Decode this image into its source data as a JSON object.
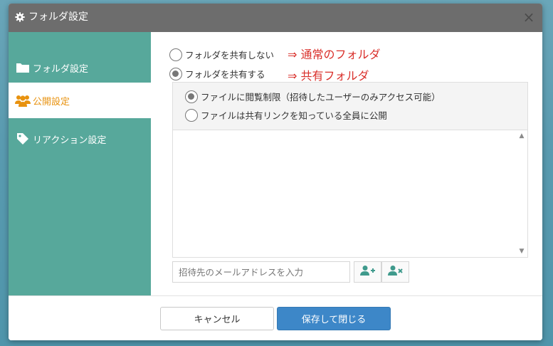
{
  "dialog": {
    "title": "フォルダ設定",
    "close_label": "×"
  },
  "sidebar": {
    "items": [
      {
        "label": "フォルダ設定",
        "icon": "folder-icon",
        "active": false
      },
      {
        "label": "公開設定",
        "icon": "users-icon",
        "active": true
      },
      {
        "label": "リアクション設定",
        "icon": "tag-icon",
        "active": false
      }
    ]
  },
  "sharing": {
    "options": [
      {
        "label": "フォルダを共有しない",
        "checked": false,
        "note": "⇒ 通常のフォルダ"
      },
      {
        "label": "フォルダを共有する",
        "checked": true,
        "note": "⇒ 共有フォルダ"
      }
    ],
    "access": [
      {
        "label": "ファイルに閲覧制限（招待したユーザーのみアクセス可能）",
        "checked": true
      },
      {
        "label": "ファイルは共有リンクを知っている全員に公開",
        "checked": false
      }
    ]
  },
  "invite": {
    "placeholder": "招待先のメールアドレスを入力",
    "value": "",
    "add_icon": "add-user-icon",
    "remove_icon": "remove-user-icon"
  },
  "scroll": {
    "up": "▲",
    "down": "▼"
  },
  "footer": {
    "cancel_label": "キャンセル",
    "save_label": "保存して閉じる"
  },
  "colors": {
    "titlebar": "#6d6d6d",
    "sidebar": "#57a89b",
    "active_text": "#e8920f",
    "annotation": "#d9302b",
    "primary": "#3d87c8"
  }
}
